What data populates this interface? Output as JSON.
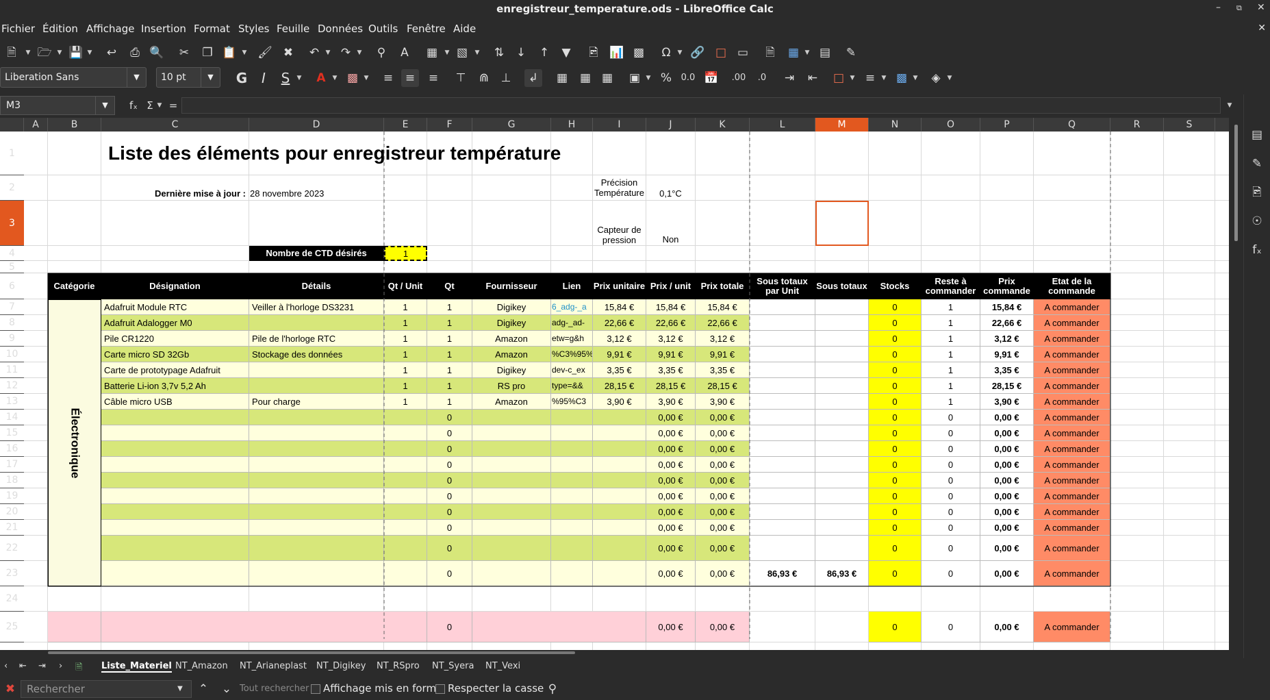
{
  "window": {
    "title": "enregistreur_temperature.ods - LibreOffice Calc"
  },
  "menu": [
    "Fichier",
    "Édition",
    "Affichage",
    "Insertion",
    "Format",
    "Styles",
    "Feuille",
    "Données",
    "Outils",
    "Fenêtre",
    "Aide"
  ],
  "font": {
    "name": "Liberation Sans",
    "size": "10 pt"
  },
  "namebox": "M3",
  "formula_symbols": {
    "fx": "fₓ",
    "sum": "Σ",
    "eq": "="
  },
  "columns": [
    "A",
    "B",
    "C",
    "D",
    "E",
    "F",
    "G",
    "H",
    "I",
    "J",
    "K",
    "L",
    "M",
    "N",
    "O",
    "P",
    "Q",
    "R",
    "S"
  ],
  "rows": [
    "1",
    "2",
    "3",
    "4",
    "5",
    "6",
    "7",
    "8",
    "9",
    "10",
    "11",
    "12",
    "13",
    "14",
    "15",
    "16",
    "17",
    "18",
    "19",
    "20",
    "21",
    "22",
    "23",
    "24",
    "25"
  ],
  "sheet": {
    "title": "Liste des éléments pour enregistreur température",
    "last_update_label": "Dernière mise à jour :",
    "last_update_value": "28 novembre 2023",
    "precision_label": "Précision Température",
    "precision_value": "0,1°C",
    "pressure_label": "Capteur de pression",
    "pressure_value": "Non",
    "ctd_label": "Nombre de CTD désirés",
    "ctd_value": "1",
    "category": "Électronique",
    "headers": [
      "Catégorie",
      "Désignation",
      "Détails",
      "Qt / Unit",
      "Qt",
      "Fournisseur",
      "Lien",
      "Prix unitaire",
      "Prix / unit",
      "Prix totale",
      "Sous totaux par Unit",
      "Sous totaux",
      "Stocks",
      "Reste à commander",
      "Prix commande",
      "Etat de la commande"
    ],
    "items": [
      {
        "designation": "Adafruit Module RTC",
        "details": "Veiller à l'horloge DS3231",
        "qtu": "1",
        "qt": "1",
        "fournisseur": "Digikey",
        "lien": "6_adg-_a",
        "pu": "15,84 €",
        "pun": "15,84 €",
        "pt": "15,84 €",
        "stock": "0",
        "reste": "1",
        "pc": "15,84 €",
        "etat": "A commander"
      },
      {
        "designation": "Adafruit Adalogger M0",
        "details": "",
        "qtu": "1",
        "qt": "1",
        "fournisseur": "Digikey",
        "lien": "adg-_ad-",
        "pu": "22,66 €",
        "pun": "22,66 €",
        "pt": "22,66 €",
        "stock": "0",
        "reste": "1",
        "pc": "22,66 €",
        "etat": "A commander"
      },
      {
        "designation": "Pile CR1220",
        "details": "Pile de l'horloge RTC",
        "qtu": "1",
        "qt": "1",
        "fournisseur": "Amazon",
        "lien": "etw=g&h",
        "pu": "3,12 €",
        "pun": "3,12 €",
        "pt": "3,12 €",
        "stock": "0",
        "reste": "1",
        "pc": "3,12 €",
        "etat": "A commander"
      },
      {
        "designation": "Carte micro SD 32Gb",
        "details": "Stockage des données",
        "qtu": "1",
        "qt": "1",
        "fournisseur": "Amazon",
        "lien": "%C3%95%",
        "pu": "9,91 €",
        "pun": "9,91 €",
        "pt": "9,91 €",
        "stock": "0",
        "reste": "1",
        "pc": "9,91 €",
        "etat": "A commander"
      },
      {
        "designation": "Carte de prototypage Adafruit",
        "details": "",
        "qtu": "1",
        "qt": "1",
        "fournisseur": "Digikey",
        "lien": "dev-c_ex",
        "pu": "3,35 €",
        "pun": "3,35 €",
        "pt": "3,35 €",
        "stock": "0",
        "reste": "1",
        "pc": "3,35 €",
        "etat": "A commander"
      },
      {
        "designation": "Batterie Li-ion 3,7v 5,2 Ah",
        "details": "",
        "qtu": "1",
        "qt": "1",
        "fournisseur": "RS pro",
        "lien": "type=&&",
        "pu": "28,15 €",
        "pun": "28,15 €",
        "pt": "28,15 €",
        "stock": "0",
        "reste": "1",
        "pc": "28,15 €",
        "etat": "A commander"
      },
      {
        "designation": "Câble micro USB",
        "details": "Pour charge",
        "qtu": "1",
        "qt": "1",
        "fournisseur": "Amazon",
        "lien": "%95%C3",
        "pu": "3,90 €",
        "pun": "3,90 €",
        "pt": "3,90 €",
        "stock": "0",
        "reste": "1",
        "pc": "3,90 €",
        "etat": "A commander"
      }
    ],
    "empty_row": {
      "qt": "0",
      "pun": "0,00 €",
      "pt": "0,00 €",
      "stock": "0",
      "reste": "0",
      "pc": "0,00 €",
      "etat": "A commander"
    },
    "subtotal_unit": "86,93 €",
    "subtotal": "86,93 €"
  },
  "sheet_tabs": [
    "Liste_Materiel",
    "NT_Amazon",
    "NT_Arianeplast",
    "NT_Digikey",
    "NT_RSpro",
    "NT_Syera",
    "NT_Vexi"
  ],
  "find": {
    "placeholder": "Rechercher",
    "search_all": "Tout rechercher",
    "formatted_display": "Affichage mis en forme",
    "match_case": "Respecter la casse"
  }
}
